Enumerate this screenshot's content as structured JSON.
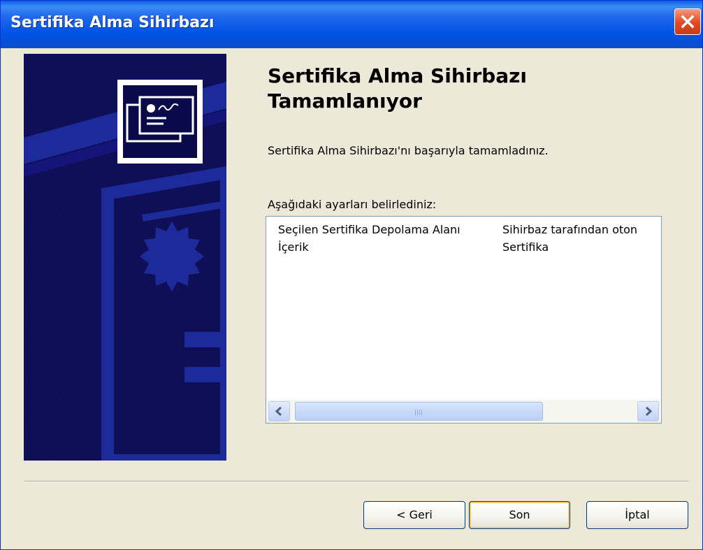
{
  "window": {
    "title": "Sertifika Alma Sihirbazı",
    "close_label": "Kapat"
  },
  "content": {
    "heading_line1": "Sertifika Alma Sihirbazı",
    "heading_line2": "Tamamlanıyor",
    "completion_message": "Sertifika Alma Sihirbazı'nı başarıyla tamamladınız.",
    "settings_label": "Aşağıdaki ayarları belirlediniz:",
    "settings": [
      {
        "name": "Seçilen Sertifika Depolama Alanı",
        "value": "Sihirbaz tarafından oton"
      },
      {
        "name": "İçerik",
        "value": "Sertifika"
      }
    ]
  },
  "buttons": {
    "back": "< Geri",
    "finish": "Son",
    "cancel": "İptal"
  },
  "colors": {
    "titlebar": "#0054e3",
    "side_panel": "#0a0a4a",
    "dialog_bg": "#ece9d8"
  },
  "icons": [
    "certificate-icon",
    "close-icon",
    "scroll-left-icon",
    "scroll-right-icon"
  ]
}
